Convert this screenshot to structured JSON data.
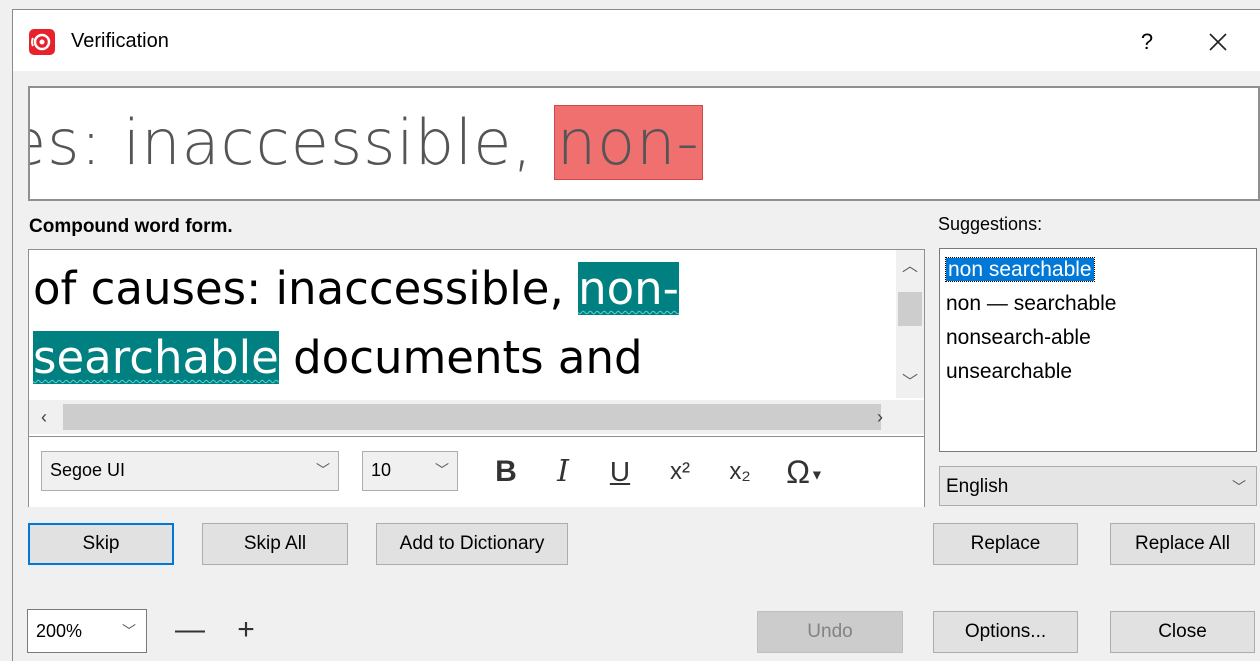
{
  "window": {
    "title": "Verification",
    "help_label": "?",
    "close_icon": "close-icon"
  },
  "preview": {
    "text_before": "es: inaccessible, ",
    "highlight": "non-"
  },
  "error": {
    "message": "Compound word form."
  },
  "editor": {
    "line1_before": "of causes: inaccessible, ",
    "line1_error": "non-",
    "line2_error": "searchable",
    "line2_after": " documents and"
  },
  "format": {
    "font_name": "Segoe UI",
    "font_size": "10",
    "bold": "B",
    "italic": "I",
    "underline": "U",
    "superscript": "x²",
    "subscript": "x₂",
    "symbol": "Ω"
  },
  "suggestions": {
    "label": "Suggestions:",
    "items": [
      "non searchable",
      "non — searchable",
      "nonsearch-able",
      "unsearchable"
    ],
    "selected_index": 0
  },
  "language": "English",
  "buttons": {
    "skip": "Skip",
    "skip_all": "Skip All",
    "add_to_dictionary": "Add to Dictionary",
    "replace": "Replace",
    "replace_all": "Replace All",
    "undo": "Undo",
    "options": "Options...",
    "close": "Close"
  },
  "zoom": {
    "value": "200%",
    "minus": "—",
    "plus": "+"
  },
  "colors": {
    "app_icon": "#e8222c",
    "error_highlight": "#008080",
    "preview_highlight": "#f07070",
    "selection": "#0078d7"
  }
}
